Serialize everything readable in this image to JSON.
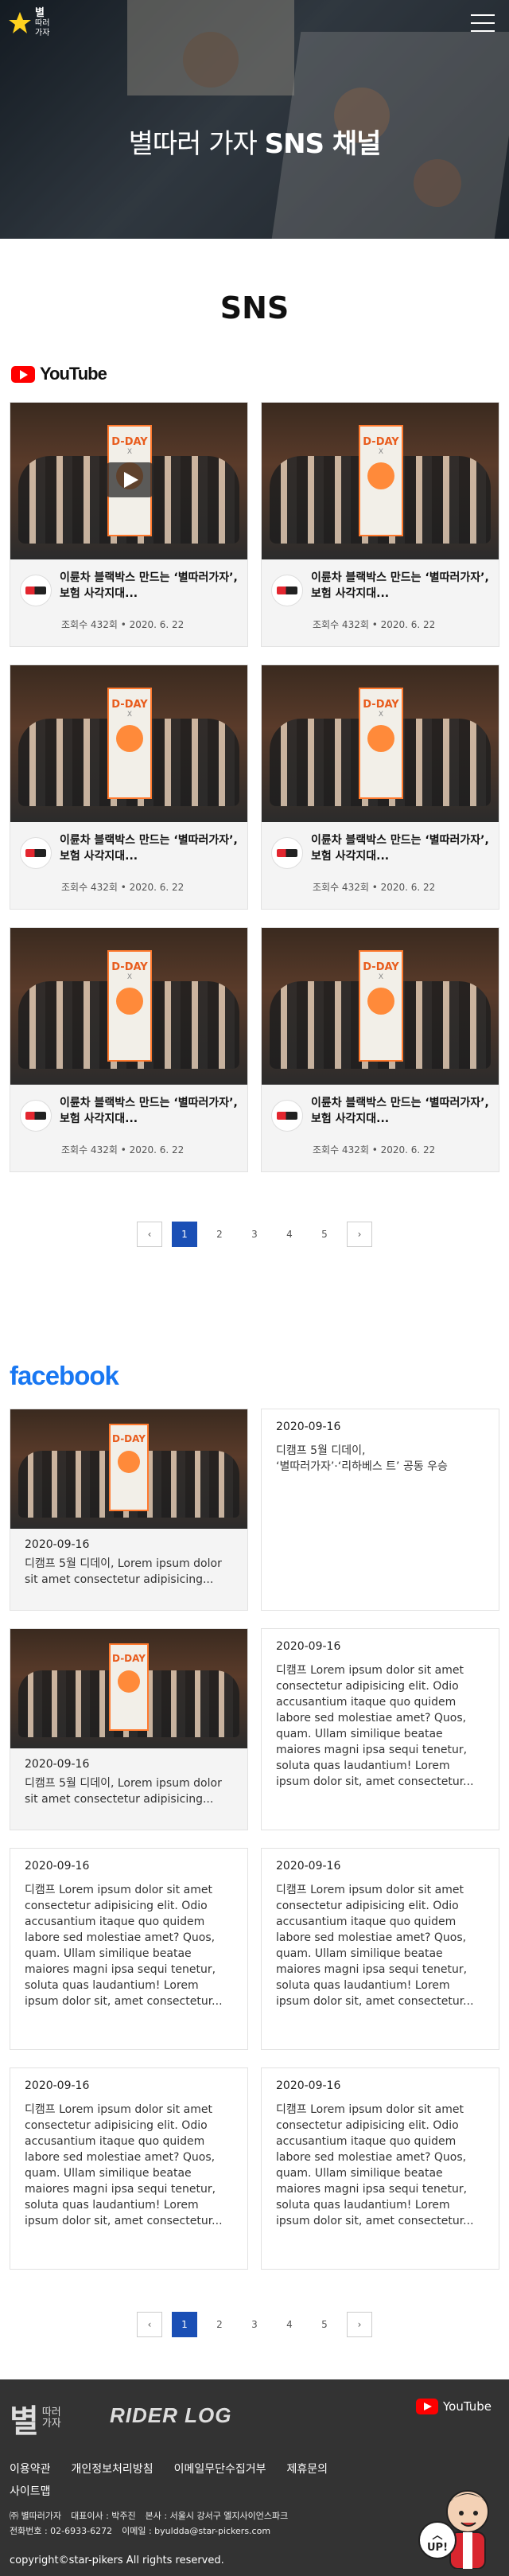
{
  "brand": {
    "logo_text": "별",
    "logo_sub": "따러\n가자"
  },
  "hero": {
    "title_prefix": "별따러 가자",
    "title_bold": "SNS 채널"
  },
  "section_title": "SNS",
  "youtube": {
    "label": "YouTube",
    "videos": [
      {
        "title": "이륜차 블랙박스 만드는 ‘별따러가자’,보험 사각지대...",
        "meta": "조회수 432회 • 2020. 6. 22"
      },
      {
        "title": "이륜차 블랙박스 만드는 ‘별따러가자’,보험 사각지대...",
        "meta": "조회수 432회 • 2020. 6. 22"
      },
      {
        "title": "이륜차 블랙박스 만드는 ‘별따러가자’,보험 사각지대...",
        "meta": "조회수 432회 • 2020. 6. 22"
      },
      {
        "title": "이륜차 블랙박스 만드는 ‘별따러가자’,보험 사각지대...",
        "meta": "조회수 432회 • 2020. 6. 22"
      },
      {
        "title": "이륜차 블랙박스 만드는 ‘별따러가자’,보험 사각지대...",
        "meta": "조회수 432회 • 2020. 6. 22"
      },
      {
        "title": "이륜차 블랙박스 만드는 ‘별따러가자’,보험 사각지대...",
        "meta": "조회수 432회 • 2020. 6. 22"
      }
    ],
    "thumb_banner": "D-DAY",
    "thumb_banner_x": "X",
    "pagination": {
      "prev": "‹",
      "next": "›",
      "pages": [
        "1",
        "2",
        "3",
        "4",
        "5"
      ],
      "active": "1"
    }
  },
  "facebook": {
    "label": "facebook",
    "posts": [
      {
        "date": "2020-09-16",
        "text": "디캠프 5월 디데이, Lorem ipsum dolor sit amet consectetur adipisicing...",
        "has_image": true
      },
      {
        "date": "2020-09-16",
        "text": "디캠프 5월 디데이,\n‘별따러가자’·‘리하베스 트’ 공동 우승",
        "has_image": false
      },
      {
        "date": "2020-09-16",
        "text": "디캠프 5월 디데이, Lorem ipsum dolor sit amet consectetur adipisicing...",
        "has_image": true
      },
      {
        "date": "2020-09-16",
        "text": "디캠프 Lorem ipsum dolor sit amet consectetur adipisicing elit. Odio accusantium itaque quo quidem labore sed molestiae amet? Quos, quam. Ullam similique beatae maiores magni ipsa sequi tenetur, soluta quas laudantium! Lorem ipsum dolor sit, amet consectetur...",
        "has_image": false
      },
      {
        "date": "2020-09-16",
        "text": "디캠프 Lorem ipsum dolor sit amet consectetur adipisicing elit. Odio accusantium itaque quo quidem labore sed molestiae amet? Quos, quam. Ullam similique beatae maiores magni ipsa sequi tenetur, soluta quas laudantium! Lorem ipsum dolor sit, amet consectetur...",
        "has_image": false
      },
      {
        "date": "2020-09-16",
        "text": "디캠프 Lorem ipsum dolor sit amet consectetur adipisicing elit. Odio accusantium itaque quo quidem labore sed molestiae amet? Quos, quam. Ullam similique beatae maiores magni ipsa sequi tenetur, soluta quas laudantium! Lorem ipsum dolor sit, amet consectetur...",
        "has_image": false
      },
      {
        "date": "2020-09-16",
        "text": "디캠프 Lorem ipsum dolor sit amet consectetur adipisicing elit. Odio accusantium itaque quo quidem labore sed molestiae amet? Quos, quam. Ullam similique beatae maiores magni ipsa sequi tenetur, soluta quas laudantium! Lorem ipsum dolor sit, amet consectetur...",
        "has_image": false
      },
      {
        "date": "2020-09-16",
        "text": "디캠프 Lorem ipsum dolor sit amet consectetur adipisicing elit. Odio accusantium itaque quo quidem labore sed molestiae amet? Quos, quam. Ullam similique beatae maiores magni ipsa sequi tenetur, soluta quas laudantium! Lorem ipsum dolor sit, amet consectetur...",
        "has_image": false
      }
    ],
    "pagination": {
      "prev": "‹",
      "next": "›",
      "pages": [
        "1",
        "2",
        "3",
        "4",
        "5"
      ],
      "active": "1"
    }
  },
  "footer": {
    "logo_main": "별",
    "logo_sub": "따러\n가자",
    "logo_rider": "RIDER LOG",
    "youtube_label": "YouTube",
    "links": [
      "이용약관",
      "개인정보처리방침",
      "이메일무단수집거부",
      "제휴문의",
      "사이트맵"
    ],
    "info_line1": [
      "㈜ 별따러가자",
      "대표이사 : 박주진",
      "본사 : 서울시 강서구 엘지사이언스파크"
    ],
    "info_line2": [
      "전화번호 : 02-6933-6272",
      "이메일 : byuldda@star-pickers.com"
    ],
    "copyright": "copyright©star-pikers All rights reserved.",
    "up_label": "UP!"
  },
  "colors": {
    "accent_blue": "#1a4fb5",
    "youtube_red": "#ff0000",
    "facebook_blue": "#1877f2",
    "footer_bg": "#333333"
  }
}
